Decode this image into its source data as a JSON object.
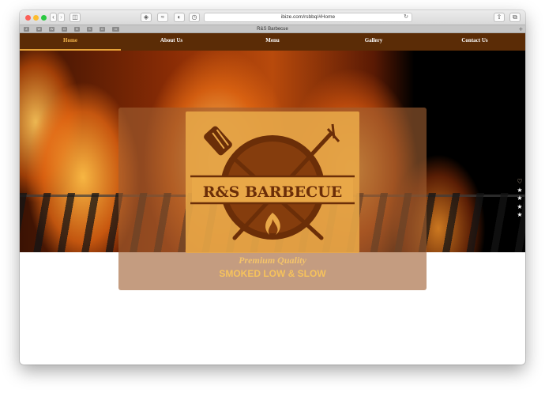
{
  "browser": {
    "url": "ibize.com/rsbbq/#Home",
    "tab_title": "R&S Barbecue",
    "favorites": [
      "Z",
      "W",
      "W",
      "G",
      "B",
      "S",
      "G",
      "▭"
    ],
    "new_tab": "+"
  },
  "nav": {
    "items": [
      {
        "label": "Home",
        "active": true
      },
      {
        "label": "About Us",
        "active": false
      },
      {
        "label": "Menu",
        "active": false
      },
      {
        "label": "Gallery",
        "active": false
      },
      {
        "label": "Contact Us",
        "active": false
      }
    ]
  },
  "hero": {
    "logo_text": "R&S BARBECUE",
    "tagline": "Premium Quality",
    "headline": "SMOKED LOW & SLOW"
  },
  "side_icons": [
    "heart-icon",
    "star-icon",
    "star-icon",
    "star-icon",
    "star-icon"
  ],
  "colors": {
    "nav_bg": "#5b2c06",
    "accent": "#f5b64a",
    "logo_brown": "#6b2e08"
  }
}
